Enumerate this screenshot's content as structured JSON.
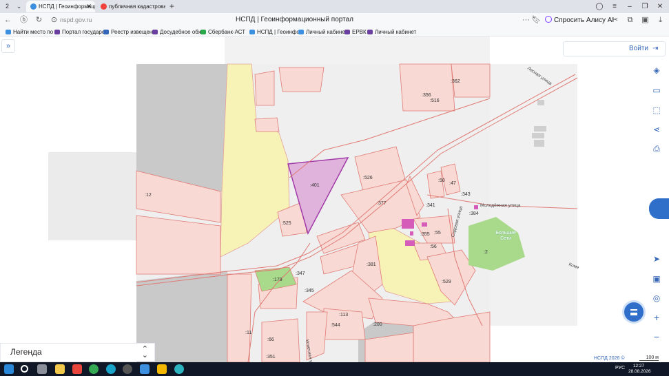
{
  "browser": {
    "tab_counter": "2",
    "tabs": [
      {
        "label": "НСПД | Геоинформаци",
        "active": true
      },
      {
        "label": "публичная кадастровая",
        "active": false
      }
    ],
    "new_tab": "+",
    "url": "nspd.gov.ru",
    "page_title": "НСПД | Геоинформационный портал",
    "alice_label": "Спросить Алису AI",
    "more_label": "···"
  },
  "bookmarks": [
    {
      "label": "Найти место по"
    },
    {
      "label": "Портал государс"
    },
    {
      "label": "Реестр извещен"
    },
    {
      "label": "Досудебное обж"
    },
    {
      "label": "Сбербанк-АСТ"
    },
    {
      "label": "НСПД | Геоинфо"
    },
    {
      "label": "Личный кабинет"
    },
    {
      "label": "ЕРВК"
    },
    {
      "label": "Личный кабинет"
    }
  ],
  "map": {
    "login_label": "Войти",
    "legend_title": "Легенда",
    "copyright": "НСПД 2026 ©",
    "scale_label": "100 м",
    "parcel_labels": [
      ":362",
      ":356",
      ":516",
      ":401",
      ":526",
      ":12",
      ":50",
      ":47",
      ":343",
      ":377",
      ":341",
      ":384",
      ":525",
      ":355",
      ":55",
      ":56",
      ":2",
      ":381",
      ":529",
      ":179",
      ":347",
      ":345",
      ":113",
      ":544",
      ":200",
      ":11",
      ":66",
      ":351"
    ],
    "street_labels": [
      "Лесная улица",
      "Молодёжная улица",
      "Садовая улица",
      "Конечная улица",
      "Коме"
    ],
    "village_label": "Большие Сети"
  },
  "taskbar": {
    "lang": "РУС",
    "time": "12:27",
    "date": "28.08.2026"
  },
  "colors": {
    "accent": "#3566b8",
    "parcel_fill": "#f8d9d4",
    "parcel_stroke": "#e07a74",
    "selected_parcel": "#dfb3db",
    "yellow_zone": "#f7f3b4",
    "green_zone": "#a9d98b",
    "grey_zone": "#c7c7c7"
  }
}
